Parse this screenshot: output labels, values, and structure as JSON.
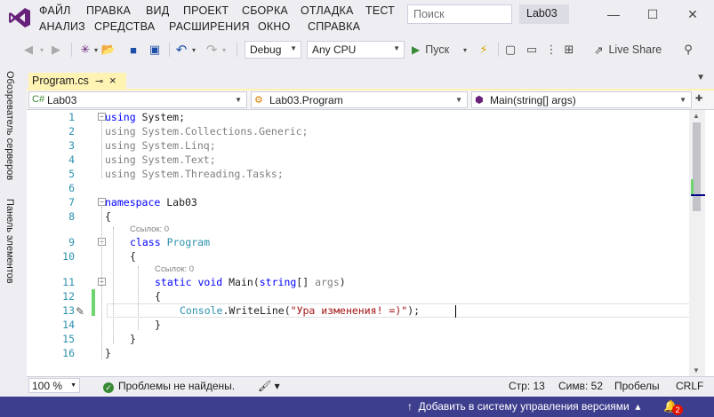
{
  "menu": {
    "row1": [
      "ФАЙЛ",
      "ПРАВКА",
      "ВИД",
      "ПРОЕКТ",
      "СБОРКА",
      "ОТЛАДКА",
      "ТЕСТ"
    ],
    "row2": [
      "АНАЛИЗ",
      "СРЕДСТВА",
      "РАСШИРЕНИЯ",
      "ОКНО",
      "СПРАВКА"
    ]
  },
  "search": {
    "placeholder": "Поиск"
  },
  "solution_name": "Lab03",
  "toolbar": {
    "configuration": "Debug",
    "platform": "Any CPU",
    "run_label": "Пуск",
    "live_share": "Live Share"
  },
  "side_tabs": [
    "Обозреватель серверов",
    "Панель элементов"
  ],
  "document_tab": {
    "label": "Program.cs"
  },
  "navbar": {
    "project": "Lab03",
    "type": "Lab03.Program",
    "member": "Main(string[] args)"
  },
  "editor": {
    "line_numbers": [
      "1",
      "2",
      "3",
      "4",
      "5",
      "6",
      "7",
      "8",
      "9",
      "10",
      "11",
      "12",
      "13",
      "14",
      "15",
      "16"
    ],
    "refs": [
      "Ссылок: 0",
      "Ссылок: 0"
    ],
    "code": {
      "l1_kw": "using",
      "l1_rest": " System;",
      "l2": "using System.Collections.Generic;",
      "l3": "using System.Linq;",
      "l4": "using System.Text;",
      "l5": "using System.Threading.Tasks;",
      "l7_kw": "namespace",
      "l7_rest": " Lab03",
      "brace_open": "{",
      "brace_close": "}",
      "l9_kw": "class",
      "l9_ty": "Program",
      "l11_kw1": "static",
      "l11_kw2": "void",
      "l11_name": "Main(",
      "l11_kw3": "string",
      "l11_rest": "[] ",
      "l11_args": "args",
      "l11_close": ")",
      "l13_ty": "Console",
      "l13_mid": ".WriteLine(",
      "l13_str": "\"Ура изменения! =)\"",
      "l13_end": ");"
    }
  },
  "status": {
    "zoom": "100 %",
    "problems": "Проблемы не найдены.",
    "line": "Стр: 13",
    "col": "Симв: 52",
    "spaces": "Пробелы",
    "eol": "CRLF"
  },
  "statusbar": {
    "source_control": "Добавить в систему управления версиями",
    "notifications": "2"
  },
  "colors": {
    "accent": "#3e3e8f",
    "tab_active": "#fff3b4",
    "keyword": "#0000ff",
    "type": "#2b91af",
    "string": "#a31515",
    "change_bar": "#6ed46e"
  }
}
